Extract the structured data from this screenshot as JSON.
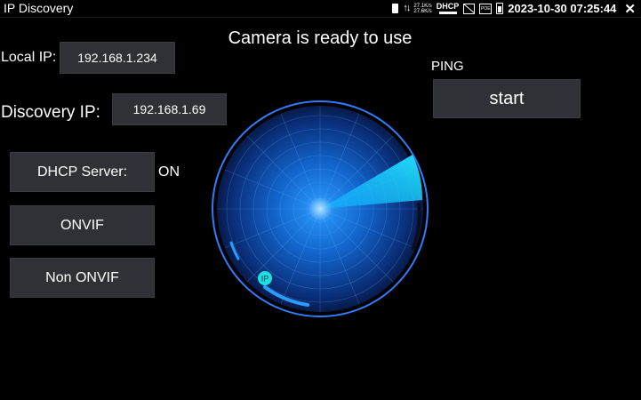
{
  "status_bar": {
    "app_title": "IP Discovery",
    "net_up": "27.1K/s",
    "net_down": "27.6K/s",
    "dhcp_label": "DHCP",
    "poe_label": "POE",
    "datetime": "2023-10-30 07:25:44"
  },
  "main": {
    "status_message": "Camera is ready to use",
    "local_ip_label": "Local IP:",
    "local_ip_value": "192.168.1.234",
    "discovery_ip_label": "Discovery IP:",
    "discovery_ip_value": "192.168.1.69",
    "dhcp_server_button": "DHCP Server:",
    "dhcp_server_state": "ON",
    "onvif_button": "ONVIF",
    "non_onvif_button": "Non ONVIF",
    "ping_label": "PING",
    "start_button": "start",
    "radar_marker_label": "IP"
  },
  "colors": {
    "background": "#000000",
    "button_bg": "#2f3136",
    "radar_blue": "#1e6ff0",
    "radar_sweep": "#19d3ff"
  }
}
